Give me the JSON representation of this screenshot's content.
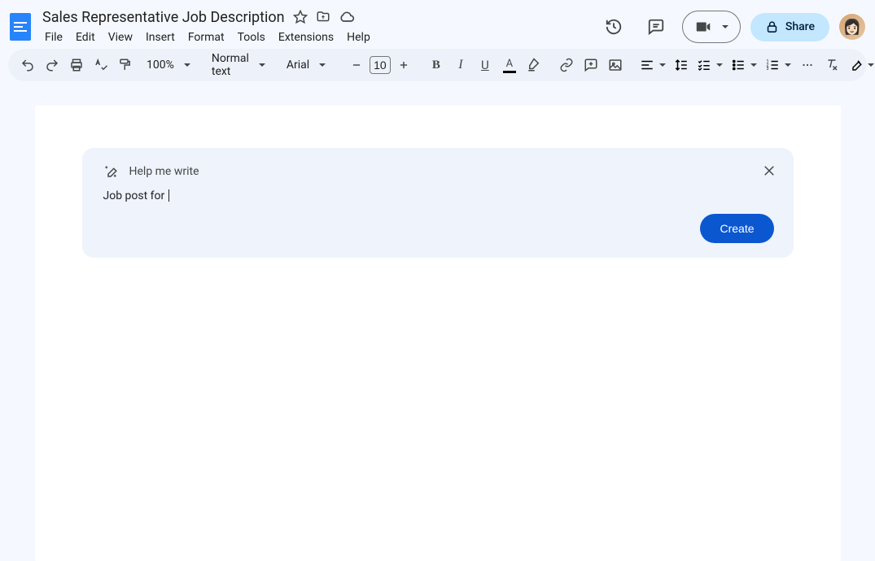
{
  "header": {
    "doc_title": "Sales Representative Job Description",
    "menus": [
      "File",
      "Edit",
      "View",
      "Insert",
      "Format",
      "Tools",
      "Extensions",
      "Help"
    ],
    "share_label": "Share"
  },
  "toolbar": {
    "zoom": "100%",
    "style": "Normal text",
    "font": "Arial",
    "font_size": "10"
  },
  "ai_panel": {
    "title": "Help me write",
    "input_text": "Job post for ",
    "create_label": "Create"
  }
}
